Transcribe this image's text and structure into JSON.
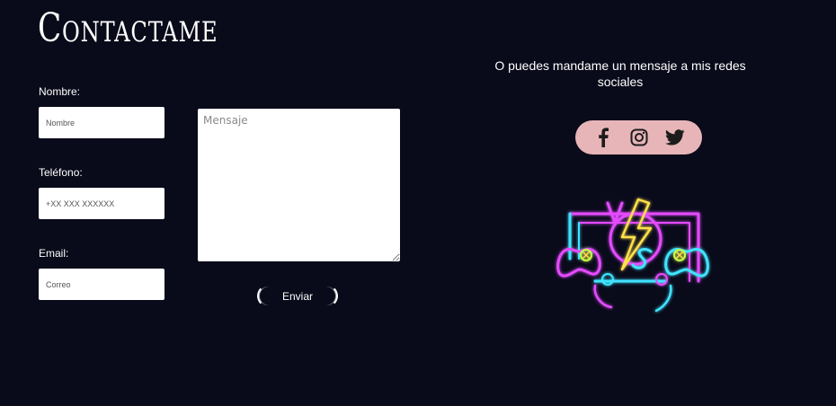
{
  "title": "Contactame",
  "form": {
    "name_label": "Nombre:",
    "name_placeholder": "Nombre",
    "phone_label": "Teléfono:",
    "phone_placeholder": "+XX XXX XXXXXX",
    "email_label": "Email:",
    "email_placeholder": "Correo",
    "message_placeholder": "Mensaje",
    "send_label": "Enviar"
  },
  "social": {
    "text": "O puedes mandame un mensaje a mis redes sociales",
    "icons": [
      "facebook-icon",
      "instagram-icon",
      "twitter-icon"
    ],
    "bar_color": "#e7b5b8"
  },
  "logo": {
    "letters_top": "V",
    "letters_bottom": "S"
  },
  "colors": {
    "background": "#090a1a",
    "neon_pink": "#e44bff",
    "neon_cyan": "#3fe3ff",
    "neon_yellow": "#ffe14a"
  }
}
